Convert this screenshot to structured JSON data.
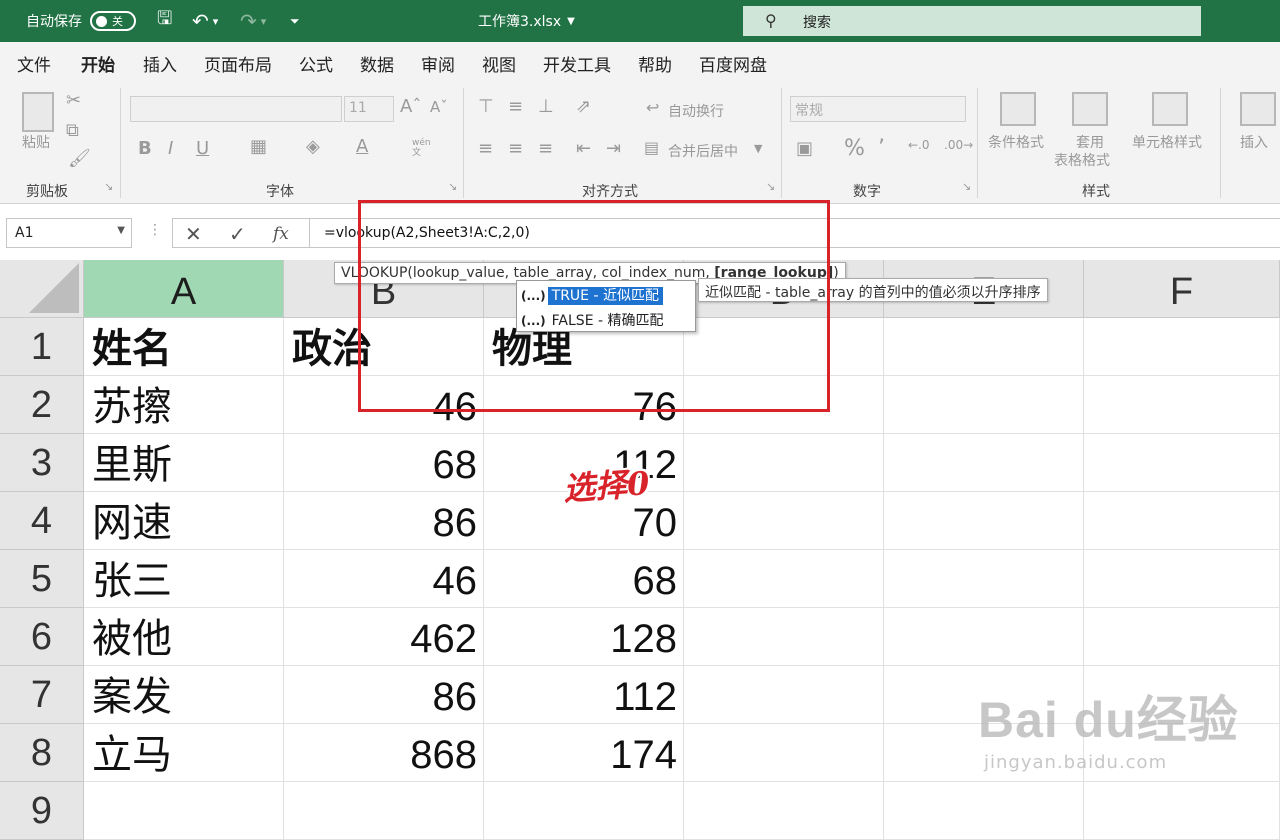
{
  "titlebar": {
    "autosave_label": "自动保存",
    "autosave_state": "关",
    "filename": "工作簿3.xlsx",
    "search_label": "搜索"
  },
  "tabs": [
    "文件",
    "开始",
    "插入",
    "页面布局",
    "公式",
    "数据",
    "审阅",
    "视图",
    "开发工具",
    "帮助",
    "百度网盘"
  ],
  "active_tab": "开始",
  "ribbon": {
    "paste_label": "粘贴",
    "font_size": "11",
    "wen_label": "wén",
    "wen_char": "文",
    "wrap_label": "自动换行",
    "merge_label": "合并后居中",
    "number_format": "常规",
    "cond_format": "条件格式",
    "table_format_1": "套用",
    "table_format_2": "表格格式",
    "cell_style": "单元格样式",
    "insert_label": "插入",
    "groups": {
      "clipboard": "剪贴板",
      "font": "字体",
      "alignment": "对齐方式",
      "number": "数字",
      "styles": "样式"
    }
  },
  "formula_bar": {
    "name_box": "A1",
    "formula": "=vlookup(A2,Sheet3!A:C,2,0)"
  },
  "columns": [
    "A",
    "B",
    "C",
    "D",
    "E",
    "F"
  ],
  "rows": [
    {
      "num": "1",
      "a": "姓名",
      "b": "政治",
      "c": "物理"
    },
    {
      "num": "2",
      "a": "苏擦",
      "b": "46",
      "c": "76"
    },
    {
      "num": "3",
      "a": "里斯",
      "b": "68",
      "c": "112"
    },
    {
      "num": "4",
      "a": "网速",
      "b": "86",
      "c": "70"
    },
    {
      "num": "5",
      "a": "张三",
      "b": "46",
      "c": "68"
    },
    {
      "num": "6",
      "a": "被他",
      "b": "462",
      "c": "128"
    },
    {
      "num": "7",
      "a": "案发",
      "b": "86",
      "c": "112"
    },
    {
      "num": "8",
      "a": "立马",
      "b": "868",
      "c": "174"
    },
    {
      "num": "9",
      "a": "",
      "b": "",
      "c": ""
    }
  ],
  "signature_tip": {
    "prefix": "VLOOKUP(lookup_value, table_array, col_index_num, ",
    "current_arg": "[range_lookup]",
    "suffix": ")"
  },
  "autocomplete": [
    {
      "tag": "(...)",
      "label": "TRUE - 近似匹配",
      "selected": true
    },
    {
      "tag": "(...)",
      "label": "FALSE - 精确匹配",
      "selected": false
    }
  ],
  "description_tip": "近似匹配 - table_array 的首列中的值必须以升序排序",
  "annotation": "选择0",
  "watermark": {
    "brand": "Bai du经验",
    "url": "jingyan.baidu.com"
  },
  "colors": {
    "excel_green": "#217346",
    "selected_header": "#a0d8b3",
    "annotation_red": "#d9232b",
    "autocomplete_blue": "#1e73d0"
  }
}
